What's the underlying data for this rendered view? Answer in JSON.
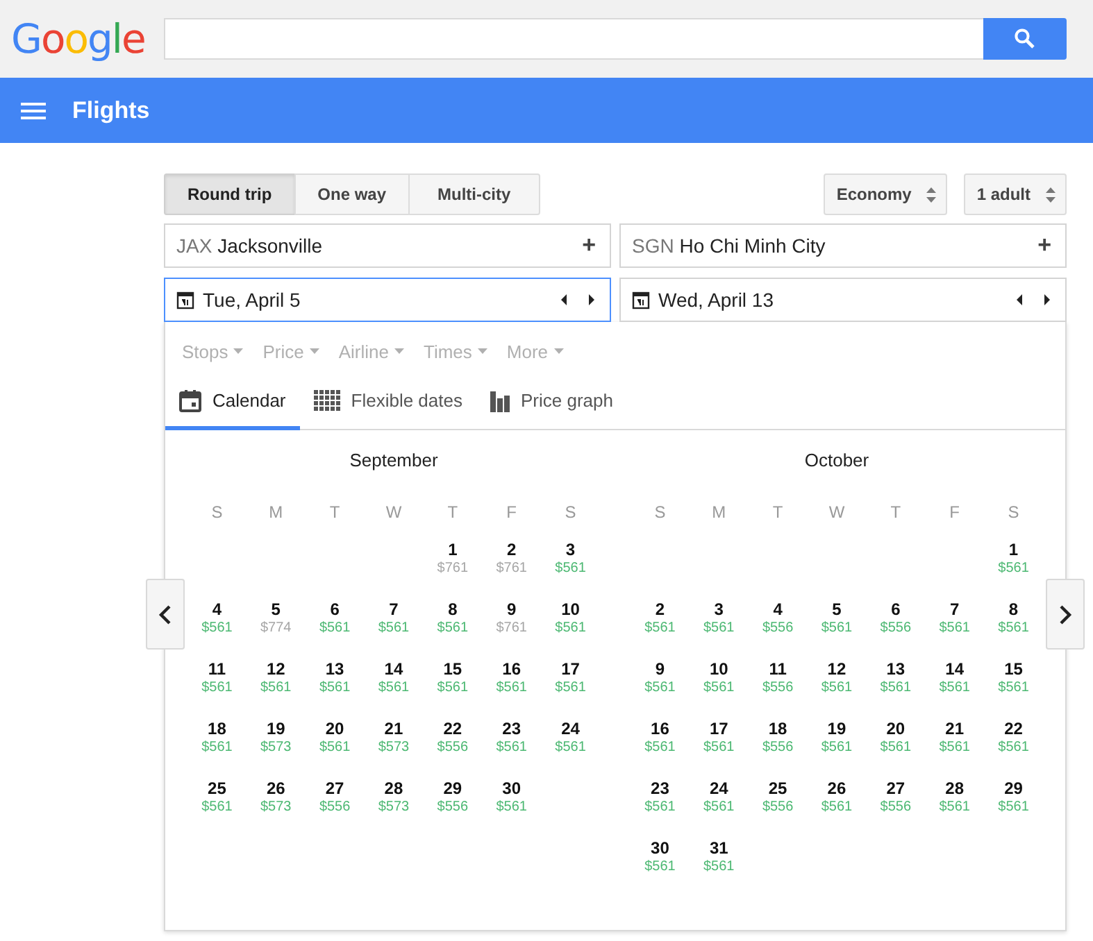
{
  "header": {
    "logo": "Google"
  },
  "app_bar": {
    "title": "Flights"
  },
  "trip_types": [
    {
      "label": "Round trip",
      "selected": true
    },
    {
      "label": "One way",
      "selected": false
    },
    {
      "label": "Multi-city",
      "selected": false
    }
  ],
  "selectors": [
    {
      "label": "Economy"
    },
    {
      "label": "1 adult"
    }
  ],
  "places": [
    {
      "code": "JAX",
      "name": "Jacksonville",
      "action": "+"
    },
    {
      "code": "SGN",
      "name": "Ho Chi Minh City",
      "action": "+"
    }
  ],
  "dates": [
    {
      "value": "Tue, April 5",
      "selected": true
    },
    {
      "value": "Wed, April 13",
      "selected": false
    }
  ],
  "filters": [
    {
      "label": "Stops",
      "disabled": true
    },
    {
      "label": "Price",
      "disabled": true
    },
    {
      "label": "Airline",
      "disabled": true
    },
    {
      "label": "Times",
      "disabled": true
    },
    {
      "label": "More",
      "disabled": true
    }
  ],
  "view_tabs": [
    {
      "label": "Calendar",
      "kind": "calendar",
      "selected": true
    },
    {
      "label": "Flexible dates",
      "kind": "grid",
      "selected": false
    },
    {
      "label": "Price graph",
      "kind": "bars",
      "selected": false
    }
  ],
  "months": [
    {
      "title": "September",
      "weekdays": [
        "S",
        "M",
        "T",
        "W",
        "T",
        "F",
        "S"
      ],
      "weeks": [
        {
          "right_aligned": true,
          "days": [
            {
              "day": "1",
              "price": "$761",
              "color": "#a6a6a6"
            },
            {
              "day": "2",
              "price": "$761",
              "color": "#a6a6a6"
            },
            {
              "day": "3",
              "price": "$561",
              "color": "#4cb872"
            }
          ]
        },
        {
          "days": [
            {
              "day": "4",
              "price": "$561",
              "color": "#4cb872"
            },
            {
              "day": "5",
              "price": "$774",
              "color": "#a6a6a6"
            },
            {
              "day": "6",
              "price": "$561",
              "color": "#4cb872"
            },
            {
              "day": "7",
              "price": "$561",
              "color": "#4cb872"
            },
            {
              "day": "8",
              "price": "$561",
              "color": "#4cb872"
            },
            {
              "day": "9",
              "price": "$761",
              "color": "#a6a6a6"
            },
            {
              "day": "10",
              "price": "$561",
              "color": "#4cb872"
            }
          ]
        },
        {
          "days": [
            {
              "day": "11",
              "price": "$561",
              "color": "#4cb872"
            },
            {
              "day": "12",
              "price": "$561",
              "color": "#4cb872"
            },
            {
              "day": "13",
              "price": "$561",
              "color": "#4cb872"
            },
            {
              "day": "14",
              "price": "$561",
              "color": "#4cb872"
            },
            {
              "day": "15",
              "price": "$561",
              "color": "#4cb872"
            },
            {
              "day": "16",
              "price": "$561",
              "color": "#4cb872"
            },
            {
              "day": "17",
              "price": "$561",
              "color": "#4cb872"
            }
          ]
        },
        {
          "days": [
            {
              "day": "18",
              "price": "$561",
              "color": "#4cb872"
            },
            {
              "day": "19",
              "price": "$573",
              "color": "#4cb872"
            },
            {
              "day": "20",
              "price": "$561",
              "color": "#4cb872"
            },
            {
              "day": "21",
              "price": "$573",
              "color": "#4cb872"
            },
            {
              "day": "22",
              "price": "$556",
              "color": "#4cb872"
            },
            {
              "day": "23",
              "price": "$561",
              "color": "#4cb872"
            },
            {
              "day": "24",
              "price": "$561",
              "color": "#4cb872"
            }
          ]
        },
        {
          "days": [
            {
              "day": "25",
              "price": "$561",
              "color": "#4cb872"
            },
            {
              "day": "26",
              "price": "$573",
              "color": "#4cb872"
            },
            {
              "day": "27",
              "price": "$556",
              "color": "#4cb872"
            },
            {
              "day": "28",
              "price": "$573",
              "color": "#4cb872"
            },
            {
              "day": "29",
              "price": "$556",
              "color": "#4cb872"
            },
            {
              "day": "30",
              "price": "$561",
              "color": "#4cb872"
            }
          ]
        }
      ]
    },
    {
      "title": "October",
      "weekdays": [
        "S",
        "M",
        "T",
        "W",
        "T",
        "F",
        "S"
      ],
      "weeks": [
        {
          "right_aligned": true,
          "days": [
            {
              "day": "1",
              "price": "$561",
              "color": "#4cb872"
            }
          ]
        },
        {
          "days": [
            {
              "day": "2",
              "price": "$561",
              "color": "#4cb872"
            },
            {
              "day": "3",
              "price": "$561",
              "color": "#4cb872"
            },
            {
              "day": "4",
              "price": "$556",
              "color": "#4cb872"
            },
            {
              "day": "5",
              "price": "$561",
              "color": "#4cb872"
            },
            {
              "day": "6",
              "price": "$556",
              "color": "#4cb872"
            },
            {
              "day": "7",
              "price": "$561",
              "color": "#4cb872"
            },
            {
              "day": "8",
              "price": "$561",
              "color": "#4cb872"
            }
          ]
        },
        {
          "days": [
            {
              "day": "9",
              "price": "$561",
              "color": "#4cb872"
            },
            {
              "day": "10",
              "price": "$561",
              "color": "#4cb872"
            },
            {
              "day": "11",
              "price": "$556",
              "color": "#4cb872"
            },
            {
              "day": "12",
              "price": "$561",
              "color": "#4cb872"
            },
            {
              "day": "13",
              "price": "$561",
              "color": "#4cb872"
            },
            {
              "day": "14",
              "price": "$561",
              "color": "#4cb872"
            },
            {
              "day": "15",
              "price": "$561",
              "color": "#4cb872"
            }
          ]
        },
        {
          "days": [
            {
              "day": "16",
              "price": "$561",
              "color": "#4cb872"
            },
            {
              "day": "17",
              "price": "$561",
              "color": "#4cb872"
            },
            {
              "day": "18",
              "price": "$556",
              "color": "#4cb872"
            },
            {
              "day": "19",
              "price": "$561",
              "color": "#4cb872"
            },
            {
              "day": "20",
              "price": "$561",
              "color": "#4cb872"
            },
            {
              "day": "21",
              "price": "$561",
              "color": "#4cb872"
            },
            {
              "day": "22",
              "price": "$561",
              "color": "#4cb872"
            }
          ]
        },
        {
          "days": [
            {
              "day": "23",
              "price": "$561",
              "color": "#4cb872"
            },
            {
              "day": "24",
              "price": "$561",
              "color": "#4cb872"
            },
            {
              "day": "25",
              "price": "$556",
              "color": "#4cb872"
            },
            {
              "day": "26",
              "price": "$561",
              "color": "#4cb872"
            },
            {
              "day": "27",
              "price": "$556",
              "color": "#4cb872"
            },
            {
              "day": "28",
              "price": "$561",
              "color": "#4cb872"
            },
            {
              "day": "29",
              "price": "$561",
              "color": "#4cb872"
            }
          ]
        },
        {
          "days": [
            {
              "day": "30",
              "price": "$561",
              "color": "#4cb872"
            },
            {
              "day": "31",
              "price": "$561",
              "color": "#4cb872"
            }
          ]
        }
      ]
    }
  ]
}
